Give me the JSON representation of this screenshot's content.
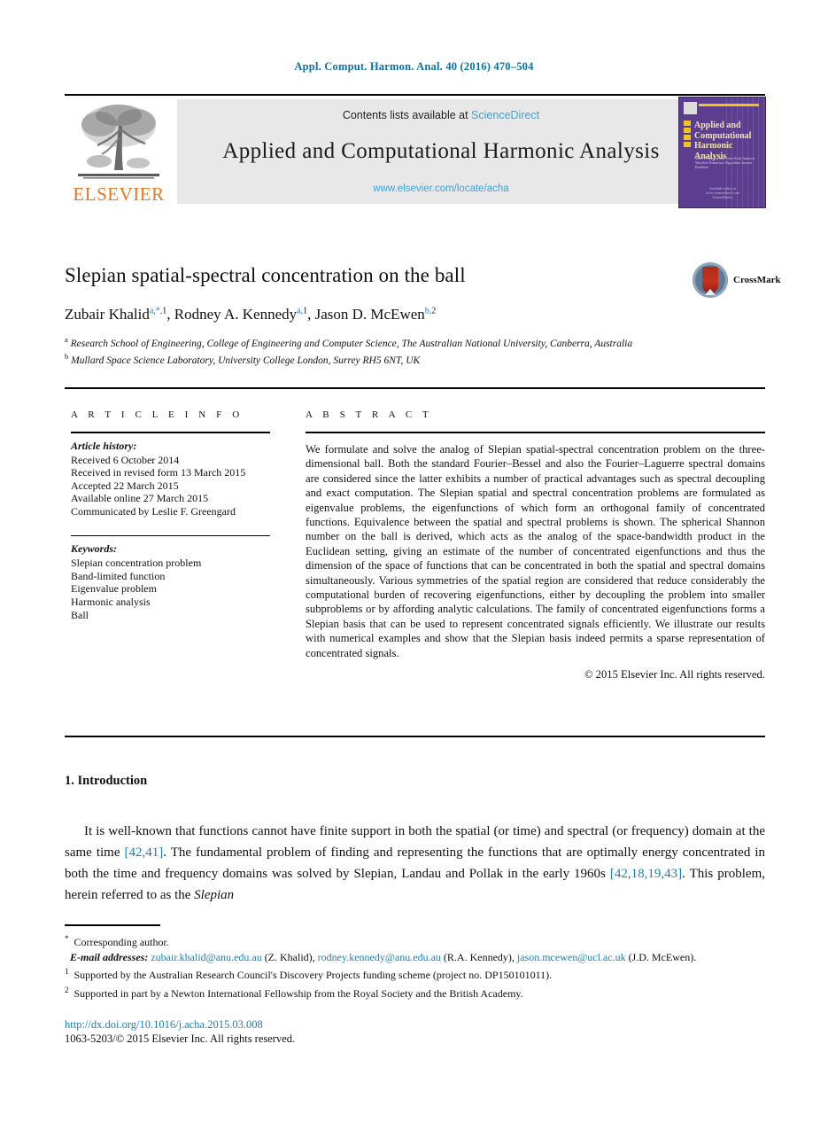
{
  "running_head": "Appl. Comput. Harmon. Anal. 40 (2016) 470–504",
  "masthead": {
    "publisher_name": "ELSEVIER",
    "contents_prefix": "Contents lists available at ",
    "contents_link": "ScienceDirect",
    "journal_title": "Applied and Computational Harmonic Analysis",
    "journal_url": "www.elsevier.com/locate/acha",
    "cover": {
      "title": "Applied and Computational Harmonic Analysis",
      "subtitle": "Time-Frequency and Time-Scale Analysis Wavelets   Numerical Algorithms Inverse Problems",
      "footer": "Available online at www.sciencedirect.com ScienceDirect"
    }
  },
  "article": {
    "title": "Slepian spatial-spectral concentration on the ball",
    "authors": [
      {
        "name": "Zubair Khalid",
        "marks": "a,*,1"
      },
      {
        "name": "Rodney A. Kennedy",
        "marks": "a,1"
      },
      {
        "name": "Jason D. McEwen",
        "marks": "b,2"
      }
    ],
    "affiliations": [
      {
        "mark": "a",
        "text": "Research School of Engineering, College of Engineering and Computer Science, The Australian National University, Canberra, Australia"
      },
      {
        "mark": "b",
        "text": "Mullard Space Science Laboratory, University College London, Surrey RH5 6NT, UK"
      }
    ],
    "crossmark_label": "CrossMark"
  },
  "info": {
    "heading": "A R T I C L E   I N F O",
    "history_label": "Article history:",
    "history": [
      "Received 6 October 2014",
      "Received in revised form 13 March 2015",
      "Accepted 22 March 2015",
      "Available online 27 March 2015",
      "Communicated by Leslie F. Greengard"
    ],
    "keywords_label": "Keywords:",
    "keywords": [
      "Slepian concentration problem",
      "Band-limited function",
      "Eigenvalue problem",
      "Harmonic analysis",
      "Ball"
    ]
  },
  "abstract": {
    "heading": "A B S T R A C T",
    "text": "We formulate and solve the analog of Slepian spatial-spectral concentration problem on the three-dimensional ball. Both the standard Fourier–Bessel and also the Fourier–Laguerre spectral domains are considered since the latter exhibits a number of practical advantages such as spectral decoupling and exact computation. The Slepian spatial and spectral concentration problems are formulated as eigenvalue problems, the eigenfunctions of which form an orthogonal family of concentrated functions. Equivalence between the spatial and spectral problems is shown. The spherical Shannon number on the ball is derived, which acts as the analog of the space-bandwidth product in the Euclidean setting, giving an estimate of the number of concentrated eigenfunctions and thus the dimension of the space of functions that can be concentrated in both the spatial and spectral domains simultaneously. Various symmetries of the spatial region are considered that reduce considerably the computational burden of recovering eigenfunctions, either by decoupling the problem into smaller subproblems or by affording analytic calculations. The family of concentrated eigenfunctions forms a Slepian basis that can be used to represent concentrated signals efficiently. We illustrate our results with numerical examples and show that the Slepian basis indeed permits a sparse representation of concentrated signals.",
    "copyright": "© 2015 Elsevier Inc. All rights reserved."
  },
  "body": {
    "section_number_title": "1. Introduction",
    "paragraph_parts": {
      "p1": "It is well-known that functions cannot have finite support in both the spatial (or time) and spectral (or frequency) domain at the same time ",
      "cite1": "[42,41]",
      "p2": ". The fundamental problem of finding and representing the functions that are optimally energy concentrated in both the time and frequency domains was solved by Slepian, Landau and Pollak in the early 1960s ",
      "cite2": "[42,18,19,43]",
      "p3": ". This problem, herein referred to as the ",
      "italic_tail": "Slepian"
    }
  },
  "footnotes": {
    "corresponding": "Corresponding author.",
    "email_label": "E-mail addresses:",
    "emails": [
      {
        "address": "zubair.khalid@anu.edu.au",
        "owner": "(Z. Khalid)"
      },
      {
        "address": "rodney.kennedy@anu.edu.au",
        "owner": "(R.A. Kennedy)"
      },
      {
        "address": "jason.mcewen@ucl.ac.uk",
        "owner": "(J.D. McEwen)"
      }
    ],
    "note1_mark": "1",
    "note1": "Supported by the Australian Research Council's Discovery Projects funding scheme (project no. DP150101011).",
    "note2_mark": "2",
    "note2": "Supported in part by a Newton International Fellowship from the Royal Society and the British Academy."
  },
  "colophon": {
    "doi": "http://dx.doi.org/10.1016/j.acha.2015.03.008",
    "issn_line": "1063-5203/© 2015 Elsevier Inc. All rights reserved."
  },
  "colors": {
    "link_blue": "#1b7fb5",
    "sciencedirect_blue": "#3ca3d8",
    "elsevier_orange": "#e87722",
    "cover_purple": "#5c3d8f"
  }
}
